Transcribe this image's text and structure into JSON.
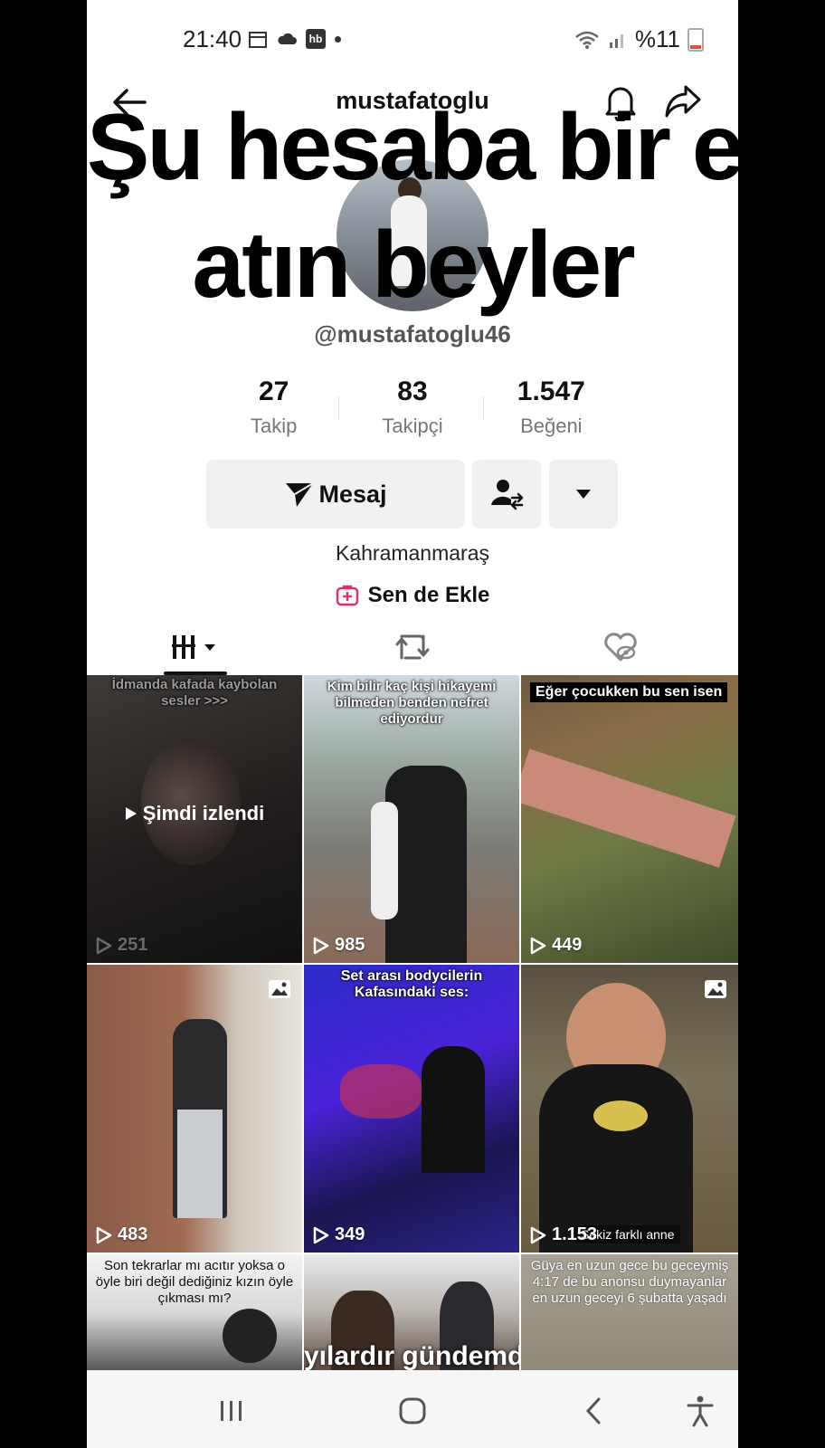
{
  "status_bar": {
    "time": "21:40",
    "hb_label": "hb",
    "battery": "%11"
  },
  "header": {
    "username": "mustafatoglu"
  },
  "overlay_text": {
    "line1": "Şu hesaba bir el",
    "line2": "atın beyler"
  },
  "profile": {
    "handle": "@mustafatoglu46",
    "stats": [
      {
        "value": "27",
        "label": "Takip"
      },
      {
        "value": "83",
        "label": "Takipçi"
      },
      {
        "value": "1.547",
        "label": "Beğeni"
      }
    ],
    "message_button": "Mesaj",
    "location": "Kahramanmaraş",
    "add_label": "Sen de Ekle"
  },
  "videos": [
    {
      "caption": "İdmanda kafada kaybolan sesler >>>",
      "views": "251",
      "watched_label": "Şimdi izlendi"
    },
    {
      "caption": "Kim bilir kaç kişi hikayemi bilmeden benden nefret ediyordur",
      "views": "985"
    },
    {
      "caption": "Eğer çocukken bu sen isen",
      "views": "449"
    },
    {
      "caption": "",
      "views": "483"
    },
    {
      "caption": "Set arası bodycilerin Kafasındaki ses:",
      "views": "349"
    },
    {
      "caption": "",
      "views": "1.153",
      "bottom_caption": "Sekiz farklı anne"
    },
    {
      "caption": "Son tekrarlar mı acıtır yoksa o öyle biri değil dediğiniz kızın öyle çıkması mı?",
      "views": ""
    },
    {
      "caption": "yılardır gündemde",
      "views": ""
    },
    {
      "caption": "Güya en uzun gece bu geceymiş 4:17 de bu anonsu duymayanlar en uzun geceyi 6 şubatta yaşadı",
      "views": ""
    }
  ]
}
